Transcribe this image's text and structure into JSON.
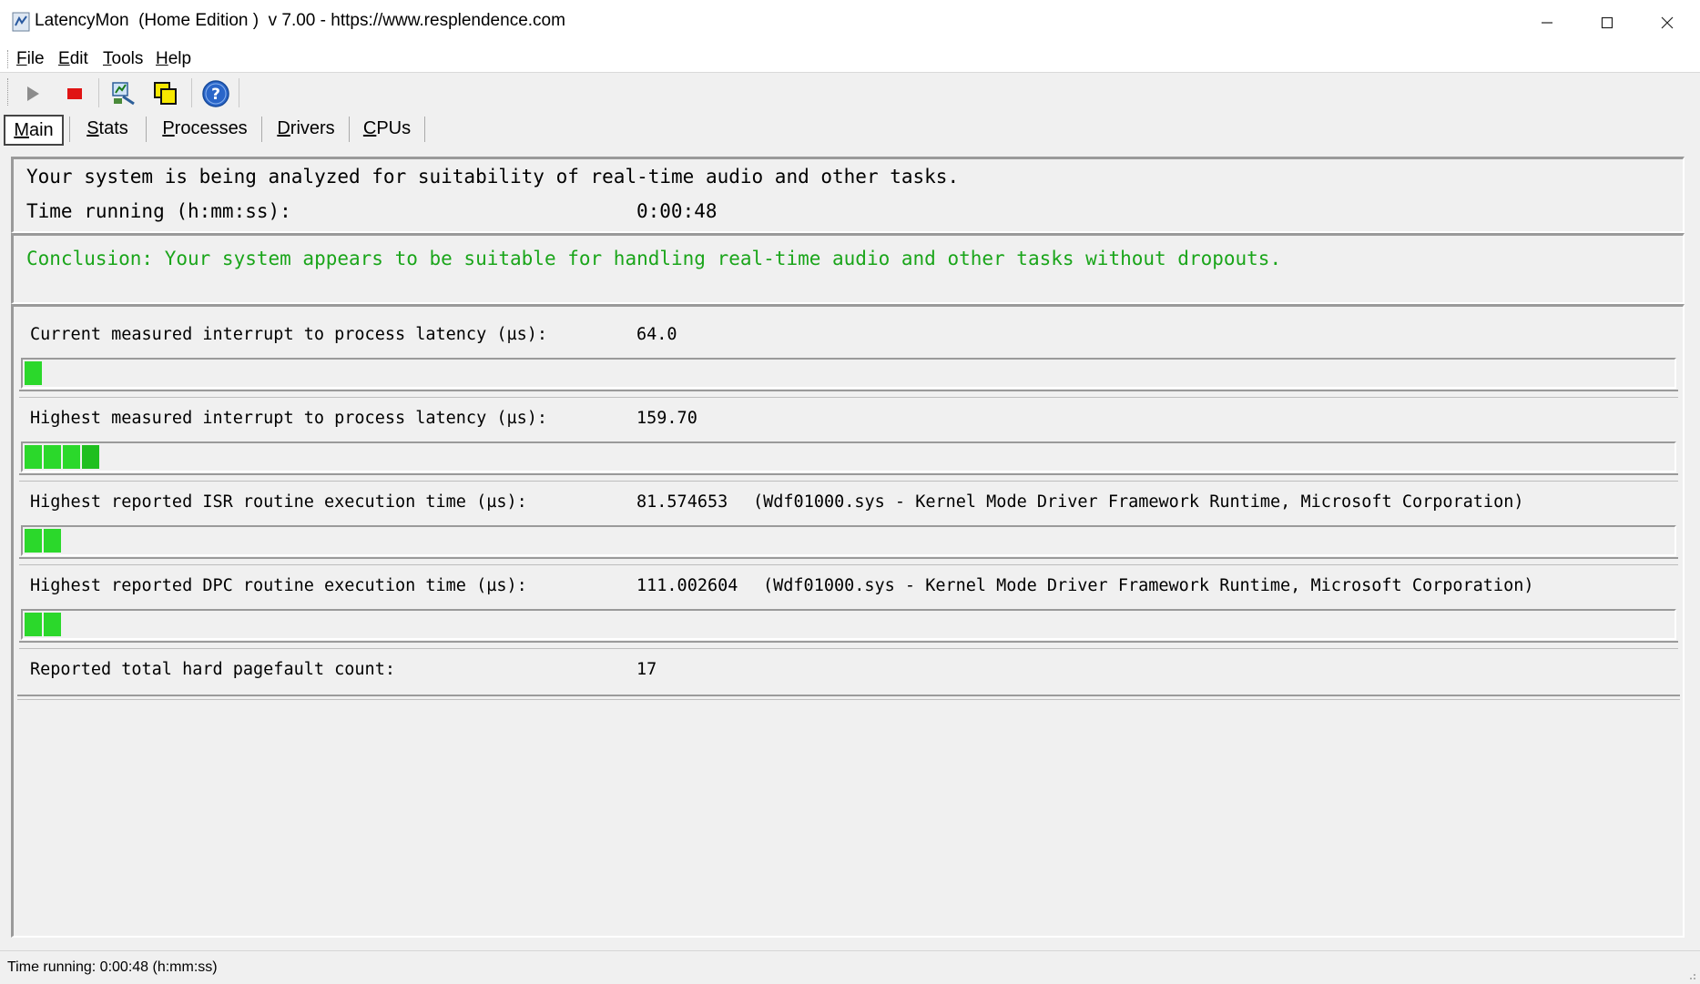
{
  "window": {
    "title": "LatencyMon  (Home Edition )  v 7.00 - https://www.resplendence.com",
    "app_icon": "latencymon-icon",
    "controls": [
      "minimize-icon",
      "maximize-icon",
      "close-icon"
    ]
  },
  "menu": {
    "items": [
      {
        "ul": "F",
        "rest": "ile"
      },
      {
        "ul": "E",
        "rest": "dit"
      },
      {
        "ul": "T",
        "rest": "ools"
      },
      {
        "ul": "H",
        "rest": "elp"
      }
    ]
  },
  "toolbar": {
    "buttons": [
      "play-icon",
      "stop-icon",
      "analyze-icon",
      "copy-icon",
      "help-icon"
    ]
  },
  "tabs": [
    {
      "ul": "M",
      "rest": "ain",
      "active": true
    },
    {
      "ul": "S",
      "rest": "tats",
      "active": false
    },
    {
      "ul": "P",
      "rest": "rocesses",
      "active": false
    },
    {
      "ul": "D",
      "rest": "rivers",
      "active": false
    },
    {
      "ul": "C",
      "rest": "PUs",
      "active": false
    }
  ],
  "status_panel": {
    "message": "Your system is being analyzed for suitability of real-time audio and other tasks.",
    "time_label": "Time running (h:mm:ss):",
    "time_value": "0:00:48"
  },
  "conclusion": {
    "text": "Conclusion: Your system appears to be suitable for handling real-time audio and other tasks without dropouts.",
    "color": "#1aa51a"
  },
  "measurements": [
    {
      "label": "Current measured interrupt to process latency (µs):",
      "value": "64.0",
      "detail": "",
      "bar_segments": 1
    },
    {
      "label": "Highest measured interrupt to process latency (µs):",
      "value": "159.70",
      "detail": "",
      "bar_segments": 4
    },
    {
      "label": "Highest reported ISR routine execution time (µs):",
      "value": "81.574653",
      "detail": "(Wdf01000.sys - Kernel Mode Driver Framework Runtime, Microsoft Corporation)",
      "bar_segments": 2
    },
    {
      "label": "Highest reported DPC routine execution time (µs):",
      "value": "111.002604",
      "detail": "(Wdf01000.sys - Kernel Mode Driver Framework Runtime, Microsoft Corporation)",
      "bar_segments": 2
    },
    {
      "label": "Reported total hard pagefault count:",
      "value": "17",
      "detail": "",
      "bar_segments": 0
    }
  ],
  "statusbar": {
    "text": "Time running: 0:00:48  (h:mm:ss)"
  }
}
